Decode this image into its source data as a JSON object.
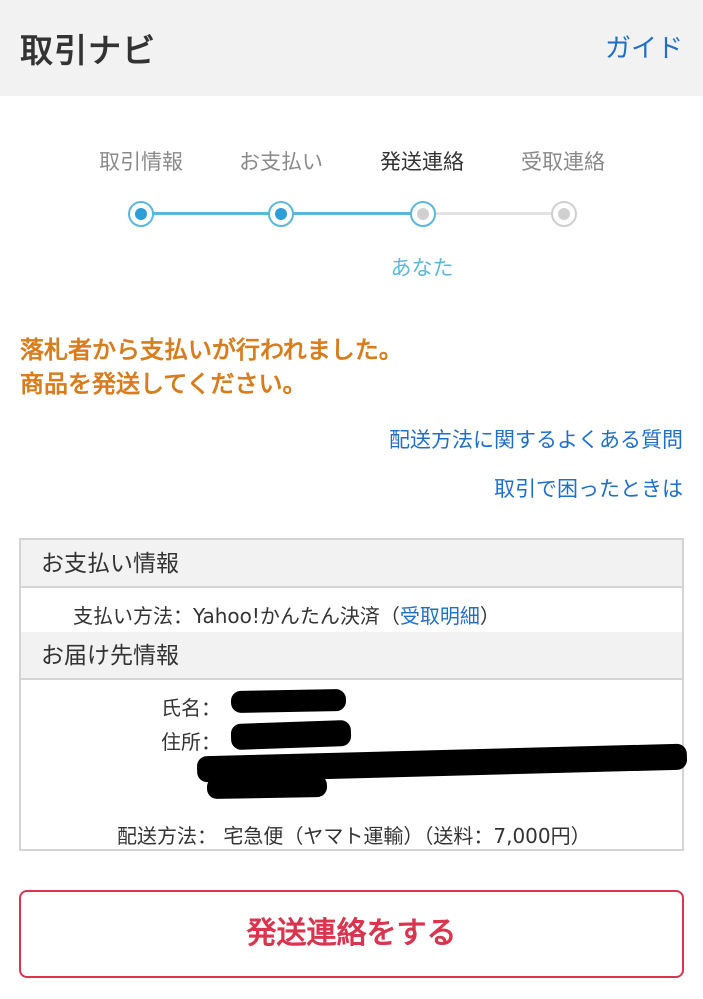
{
  "header": {
    "title": "取引ナビ",
    "guide_link": "ガイド"
  },
  "steps": {
    "items": [
      {
        "label": "取引情報",
        "state": "done"
      },
      {
        "label": "お支払い",
        "state": "done"
      },
      {
        "label": "発送連絡",
        "state": "current"
      },
      {
        "label": "受取連絡",
        "state": "pending"
      }
    ],
    "current_actor": "あなた"
  },
  "notice": {
    "line1": "落札者から支払いが行われました。",
    "line2": "商品を発送してください。"
  },
  "links": {
    "faq": "配送方法に関するよくある質問",
    "trouble": "取引で困ったときは"
  },
  "payment": {
    "heading": "お支払い情報",
    "method_label": "支払い方法：",
    "method_value": "Yahoo!かんたん決済（",
    "receipt_link": "受取明細",
    "close_paren": "）"
  },
  "delivery": {
    "heading": "お届け先情報",
    "name_label": "氏名：",
    "address_label": "住所：",
    "shipping_method_label": "配送方法：",
    "shipping_method_value": "宅急便（ヤマト運輸）（送料：7,000円）"
  },
  "action": {
    "ship_button": "発送連絡をする"
  },
  "colors": {
    "accent_blue": "#1f6fc9",
    "step_blue": "#5bb8dc",
    "notice_orange": "#d87d1d",
    "button_red": "#d9354f"
  }
}
